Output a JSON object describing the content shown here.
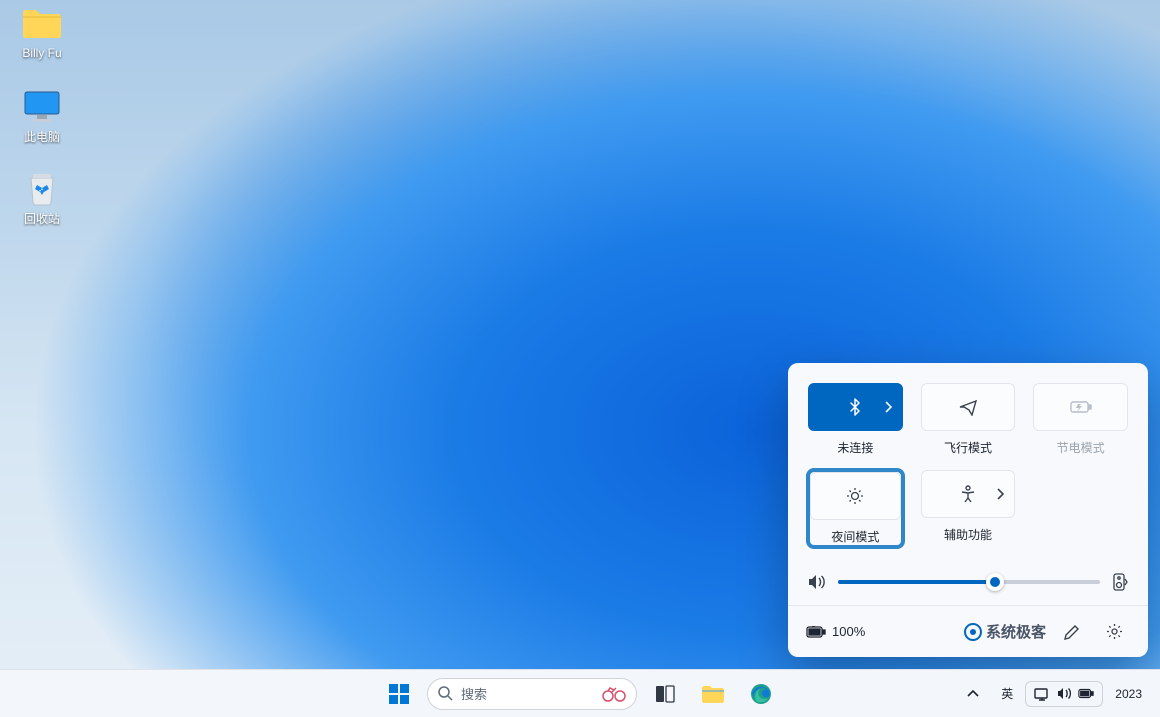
{
  "desktop_icons": {
    "user_folder": "Billy Fu",
    "this_pc": "此电脑",
    "recycle_bin": "回收站"
  },
  "taskbar": {
    "search_placeholder": "搜索",
    "lang": "英",
    "year": "2023"
  },
  "quick_settings": {
    "tiles": {
      "bluetooth": {
        "label": "未连接",
        "active": true,
        "has_chevron": true
      },
      "airplane": {
        "label": "飞行模式",
        "active": false
      },
      "battery_saver": {
        "label": "节电模式",
        "disabled": true
      },
      "night_light": {
        "label": "夜间模式",
        "highlighted": true
      },
      "accessibility": {
        "label": "辅助功能",
        "has_chevron": true
      }
    },
    "volume_percent": 60,
    "battery_text": "100%",
    "watermark": "系统极客"
  }
}
